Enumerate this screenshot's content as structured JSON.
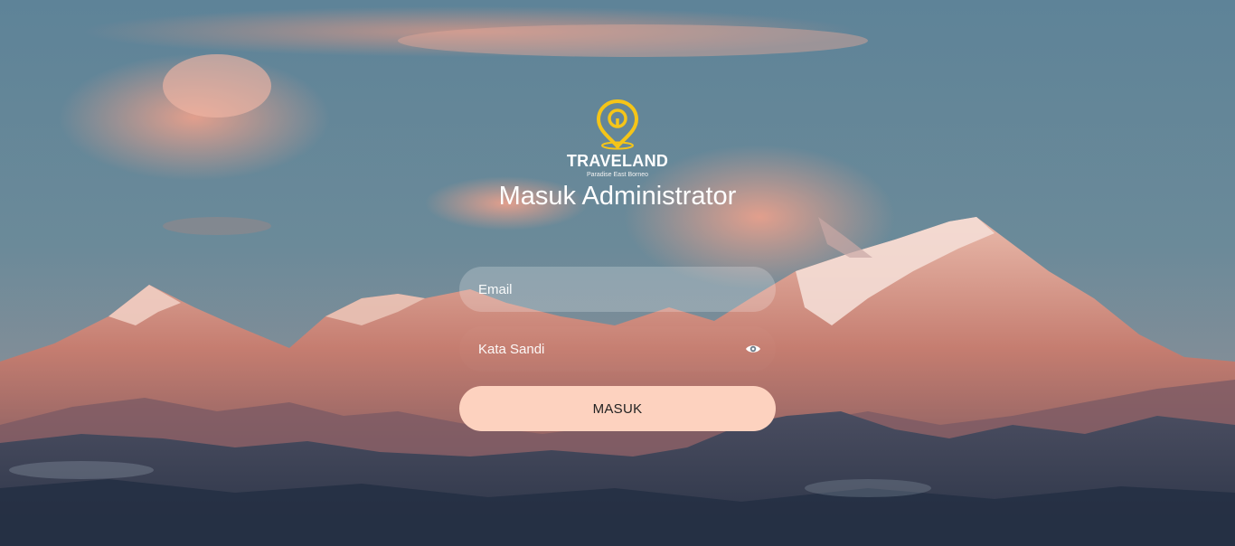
{
  "brand": {
    "name": "TRAVELAND",
    "tagline": "Paradise East Borneo",
    "logo_icon": "location-pin-icon",
    "logo_color": "#f5c518"
  },
  "page": {
    "title": "Masuk Administrator"
  },
  "form": {
    "email_placeholder": "Email",
    "email_value": "",
    "password_placeholder": "Kata Sandi",
    "password_value": "",
    "toggle_icon": "eye-icon",
    "submit_label": "MASUK"
  },
  "colors": {
    "button_background": "#fdd2bf",
    "button_text": "#222222",
    "text": "#ffffff"
  }
}
